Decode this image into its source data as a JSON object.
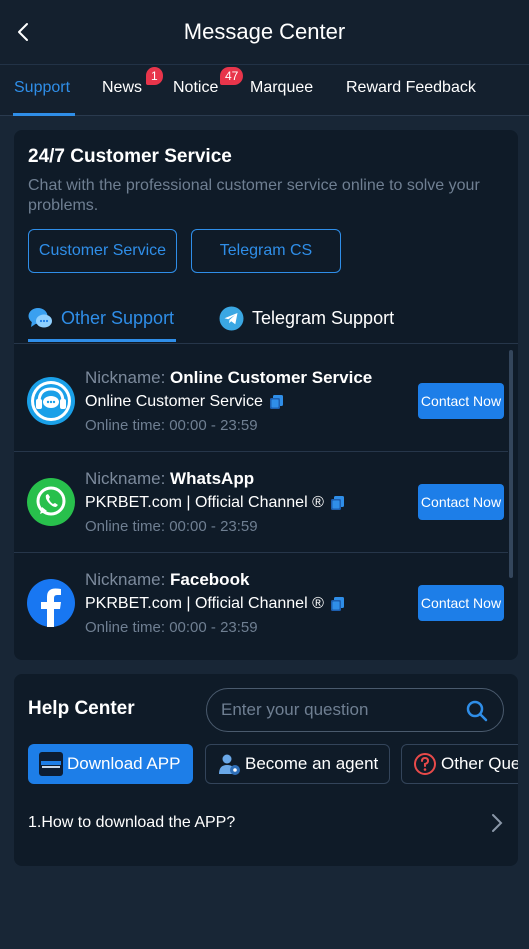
{
  "header": {
    "title": "Message Center"
  },
  "tabs": [
    {
      "label": "Support",
      "active": true
    },
    {
      "label": "News",
      "badge": "1"
    },
    {
      "label": "Notice",
      "badge": "47"
    },
    {
      "label": "Marquee"
    },
    {
      "label": "Reward Feedback"
    }
  ],
  "customer_service": {
    "title": "24/7 Customer Service",
    "description": "Chat with the professional customer service online to solve your problems.",
    "buttons": [
      "Customer Service",
      "Telegram CS"
    ]
  },
  "support_tabs": [
    {
      "label": "Other Support",
      "active": true,
      "icon": "chat-bubbles-icon"
    },
    {
      "label": "Telegram Support",
      "icon": "telegram-icon"
    }
  ],
  "contacts": [
    {
      "nickname_label": "Nickname:",
      "nickname": "Online Customer Service",
      "account": "Online Customer Service",
      "online_time": "Online time: 00:00 - 23:59",
      "button": "Contact Now",
      "icon": "headset-icon"
    },
    {
      "nickname_label": "Nickname:",
      "nickname": "WhatsApp",
      "account": "PKRBET.com | Official Channel ®",
      "online_time": "Online time: 00:00 - 23:59",
      "button": "Contact Now",
      "icon": "whatsapp-icon"
    },
    {
      "nickname_label": "Nickname:",
      "nickname": "Facebook",
      "account": "PKRBET.com | Official Channel ®",
      "online_time": "Online time: 00:00 - 23:59",
      "button": "Contact Now",
      "icon": "facebook-icon"
    }
  ],
  "help_center": {
    "title": "Help Center",
    "search_placeholder": "Enter your question",
    "categories": [
      {
        "label": "Download APP",
        "active": true,
        "icon": "app-logo-icon"
      },
      {
        "label": "Become an agent",
        "icon": "agent-icon"
      },
      {
        "label": "Other Questions",
        "icon": "question-icon"
      }
    ],
    "faq": [
      "1.How to download the APP?"
    ]
  },
  "colors": {
    "accent": "#2f8ee8",
    "badge": "#e8354b",
    "background": "#182636",
    "card": "#0f1b28"
  }
}
